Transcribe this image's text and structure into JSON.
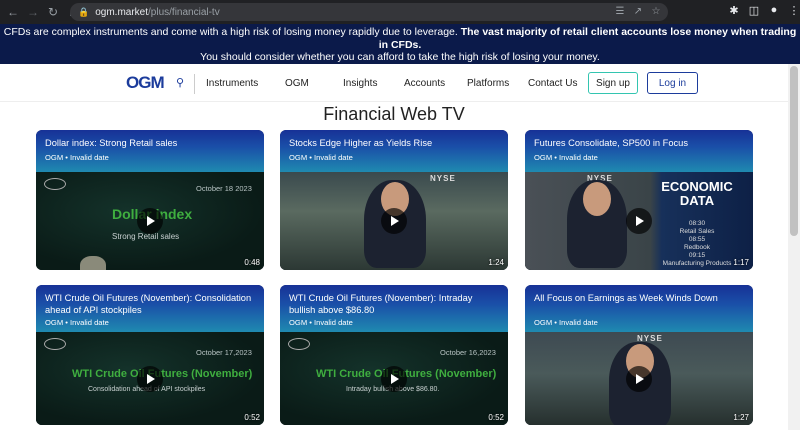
{
  "browser": {
    "host": "ogm.market",
    "path": "/plus/financial-tv"
  },
  "risk": {
    "text1": "CFDs are complex instruments and come with a high risk of losing money rapidly due to leverage.",
    "text2": "The vast majority of retail client accounts lose money when trading in CFDs.",
    "text3": "You should consider whether you can afford to take the high risk of losing your money."
  },
  "header": {
    "logo": "OGM",
    "nav": [
      "Instruments",
      "OGM",
      "Insights",
      "Accounts",
      "Platforms",
      "Contact Us"
    ],
    "signup": "Sign up",
    "login": "Log in"
  },
  "page": {
    "title": "Financial Web TV"
  },
  "cards": [
    {
      "title": "Dollar index: Strong Retail sales",
      "meta": "OGM • Invalid date",
      "duration": "0:48",
      "date": "October 18 2023",
      "big": "Dollar index",
      "sub": "Strong Retail sales"
    },
    {
      "title": "Stocks Edge Higher as Yields Rise",
      "meta": "OGM • Invalid date",
      "duration": "1:24",
      "nyse": "NYSE"
    },
    {
      "title": "Futures Consolidate, SP500 in Focus",
      "meta": "OGM • Invalid date",
      "duration": "1:17",
      "nyse": "NYSE",
      "econ": "ECONOMIC DATA",
      "econ_list": [
        "08:30",
        "Retail Sales",
        "08:55",
        "Redbook",
        "09:15",
        "Manufacturing Products"
      ]
    },
    {
      "title": "WTI Crude Oil Futures (November): Consolidation ahead of API stockpiles",
      "meta": "OGM • Invalid date",
      "duration": "0:52",
      "date": "October 17,2023",
      "big": "WTI Crude Oil Futures (November)",
      "sub": "Consolidation ahead of API stockpiles"
    },
    {
      "title": "WTI Crude Oil Futures (November): Intraday bullish above $86.80",
      "meta": "OGM • Invalid date",
      "duration": "0:52",
      "date": "October 16,2023",
      "big": "WTI Crude Oil Futures (November)",
      "sub": "Intraday bullish above $86.80."
    },
    {
      "title": "All Focus on Earnings as Week Winds Down",
      "meta": "OGM • Invalid date",
      "duration": "1:27",
      "nyse": "NYSE"
    }
  ]
}
